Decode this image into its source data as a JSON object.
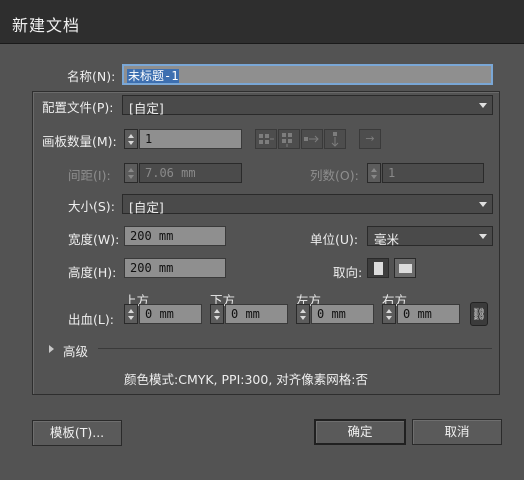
{
  "window": {
    "title": "新建文档"
  },
  "name": {
    "label": "名称(N):",
    "value": "未标题-1"
  },
  "profile": {
    "label": "配置文件(P):",
    "value": "[自定]"
  },
  "artboards": {
    "label": "画板数量(M):",
    "value": "1"
  },
  "spacing": {
    "label": "间距(I):",
    "value": "7.06 mm"
  },
  "columns": {
    "label": "列数(O):",
    "value": "1"
  },
  "size": {
    "label": "大小(S):",
    "value": "[自定]"
  },
  "width": {
    "label": "宽度(W):",
    "value": "200 mm"
  },
  "units": {
    "label": "单位(U):",
    "value": "毫米"
  },
  "height": {
    "label": "高度(H):",
    "value": "200 mm"
  },
  "orientation": {
    "label": "取向:"
  },
  "bleed": {
    "label": "出血(L):",
    "top": {
      "label": "上方",
      "value": "0 mm"
    },
    "bottom": {
      "label": "下方",
      "value": "0 mm"
    },
    "left": {
      "label": "左方",
      "value": "0 mm"
    },
    "right": {
      "label": "右方",
      "value": "0 mm"
    }
  },
  "advanced": {
    "label": "高级"
  },
  "info": "颜色模式:CMYK, PPI:300, 对齐像素网格:否",
  "buttons": {
    "templates": "模板(T)...",
    "ok": "确定",
    "cancel": "取消"
  },
  "icons": {
    "arrow_glyph": "→",
    "link_glyph": "⛓"
  }
}
